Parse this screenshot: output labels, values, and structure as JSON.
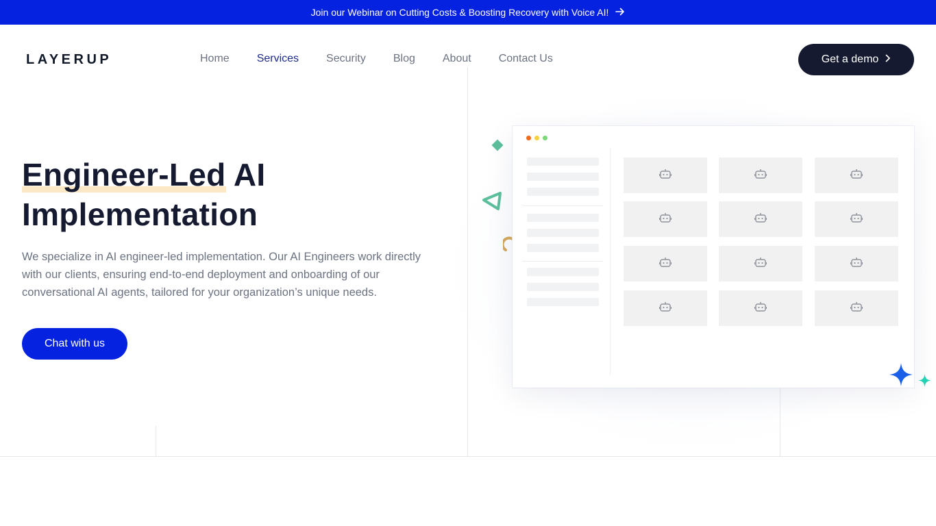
{
  "banner": {
    "text": "Join our Webinar on Cutting Costs & Boosting Recovery with Voice AI!",
    "icon": "arrow-right-icon"
  },
  "header": {
    "logo": "LAYERUP",
    "nav": {
      "home": "Home",
      "services": "Services",
      "security": "Security",
      "blog": "Blog",
      "about": "About",
      "contact": "Contact Us"
    },
    "active_nav": "Services",
    "cta_label": "Get a demo",
    "cta_icon": "chevron-right-icon"
  },
  "hero": {
    "title_highlight": "Engineer-Led",
    "title_rest": " AI Implementation",
    "description": "We specialize in AI engineer-led implementation. Our AI Engineers work directly with our clients, ensuring end-to-end deployment and onboarding of our conversational AI agents, tailored for your organization’s unique needs.",
    "cta_label": "Chat with us"
  },
  "mockup": {
    "window_dot_colors": [
      "#f06a1c",
      "#f5d23a",
      "#7ed67a"
    ],
    "tile_icon": "robot-icon"
  },
  "colors": {
    "brand_blue": "#0522e0",
    "dark_navy": "#151a30",
    "highlight": "#fde8c6",
    "accent_green": "#5cbf9b",
    "accent_star_blue": "#1a5fe8",
    "accent_star_teal": "#22d3b5"
  }
}
